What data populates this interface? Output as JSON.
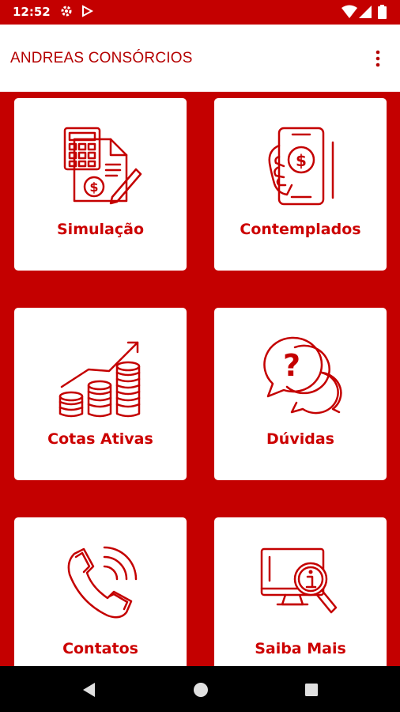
{
  "status_bar": {
    "time": "12:52",
    "icons": [
      "settings-icon",
      "play-store-icon",
      "wifi-icon",
      "signal-icon",
      "battery-icon"
    ]
  },
  "app_bar": {
    "title": "ANDREAS CONSÓRCIOS",
    "menu_icon": "more-vert-icon"
  },
  "tiles": [
    {
      "label": "Simulação",
      "icon": "calculator-document-icon"
    },
    {
      "label": "Contemplados",
      "icon": "phone-money-icon"
    },
    {
      "label": "Cotas Ativas",
      "icon": "coins-growth-icon"
    },
    {
      "label": "Dúvidas",
      "icon": "question-chat-icon"
    },
    {
      "label": "Contatos",
      "icon": "phone-call-icon"
    },
    {
      "label": "Saiba Mais",
      "icon": "info-monitor-icon"
    }
  ],
  "navigation_bar": {
    "buttons": [
      "back-icon",
      "home-icon",
      "recents-icon"
    ]
  },
  "colors": {
    "primary": "#c40000",
    "accent_text": "#cc0000",
    "card": "#ffffff",
    "nav_bar": "#000000"
  }
}
